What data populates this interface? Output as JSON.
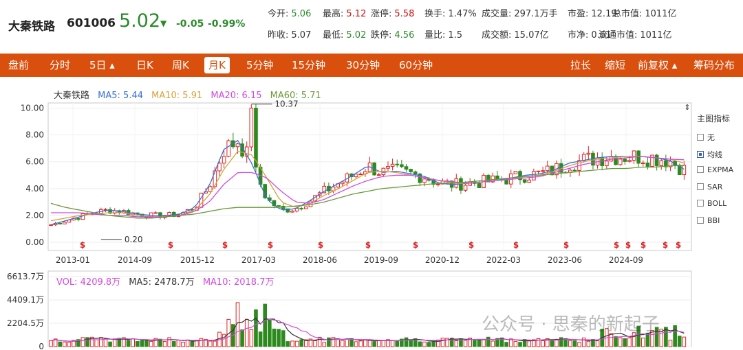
{
  "header": {
    "name": "大秦铁路",
    "code": "601006",
    "price": "5.02",
    "arrow": "▼",
    "change": "-0.05",
    "change_pct": "-0.99%",
    "quotes": [
      {
        "label": "今开:",
        "value": "5.06",
        "tone": "green"
      },
      {
        "label": "最高:",
        "value": "5.12",
        "tone": "red"
      },
      {
        "label": "涨停:",
        "value": "5.58",
        "tone": "red"
      },
      {
        "label": "换手:",
        "value": "1.47%",
        "tone": "dark"
      },
      {
        "label": "成交量:",
        "value": "297.1万手",
        "tone": "dark"
      },
      {
        "label": "市盈:",
        "value": "12.19",
        "tone": "dark"
      },
      {
        "label": "总市值:",
        "value": "1011亿",
        "tone": "dark"
      },
      {
        "label": "昨收:",
        "value": "5.07",
        "tone": "dark"
      },
      {
        "label": "最低:",
        "value": "5.02",
        "tone": "green"
      },
      {
        "label": "跌停:",
        "value": "4.56",
        "tone": "green"
      },
      {
        "label": "量比:",
        "value": "1.5",
        "tone": "dark"
      },
      {
        "label": "成交额:",
        "value": "15.07亿",
        "tone": "dark"
      },
      {
        "label": "市净:",
        "value": "0.61",
        "tone": "dark"
      },
      {
        "label": "流通市值:",
        "value": "1011亿",
        "tone": "dark"
      }
    ]
  },
  "toolbar": {
    "items": [
      "盘前",
      "分时",
      "5日 ▴",
      "日K",
      "周K",
      "月K",
      "5分钟",
      "15分钟",
      "30分钟",
      "60分钟",
      "拉长",
      "缩短",
      "前复权 ▴",
      "筹码分布"
    ],
    "active": "月K"
  },
  "ma_legend": {
    "name": "大秦铁路",
    "ma5": "MA5: 5.44",
    "ma10": "MA10: 5.91",
    "ma20": "MA20: 6.15",
    "ma60": "MA60: 5.71"
  },
  "colors": {
    "up": "#e02020",
    "down": "#2c8a1e",
    "ma5": "#3a6fd8",
    "ma10": "#d7a23a",
    "ma20": "#d04adf",
    "ma60": "#6a9a3a",
    "toolbar_bg": "#d94f0e"
  },
  "side_panel": {
    "title": "主图指标",
    "options": [
      {
        "label": "无",
        "checked": false
      },
      {
        "label": "均线",
        "checked": true
      },
      {
        "label": "EXPMA",
        "checked": false
      },
      {
        "label": "SAR",
        "checked": false
      },
      {
        "label": "BOLL",
        "checked": false
      },
      {
        "label": "BBI",
        "checked": false
      }
    ]
  },
  "price_axis": [
    "10.00",
    "8.00",
    "6.00",
    "4.00",
    "2.00",
    "0.00"
  ],
  "date_axis": [
    "2013-01",
    "2014-09",
    "2015-12",
    "2017-03",
    "2018-06",
    "2019-09",
    "2020-12",
    "2022-03",
    "2023-06",
    "2024-09"
  ],
  "annotations": {
    "high": "10.37",
    "low": "0.20"
  },
  "vol_legend": {
    "vol": "VOL: 4209.8万",
    "ma5": "MA5: 2478.7万",
    "ma10": "MA10: 2018.7万"
  },
  "vol_axis": [
    "6613.7万",
    "4409.1万",
    "2204.5万",
    "0"
  ],
  "watermark": "公众号 · 思秦的新起子",
  "chart_data": {
    "type": "candlestick",
    "price_axis_range": [
      0,
      11
    ],
    "volume_axis_range": [
      0,
      6613.7
    ],
    "volume_unit": "万",
    "series": [
      {
        "name": "MA5",
        "values": [
          1.3,
          1.6,
          1.9,
          2.2,
          2.4,
          2.3,
          2.1,
          2.0,
          2.0,
          2.1,
          2.6,
          4.2,
          6.9,
          7.6,
          5.8,
          3.2,
          2.4,
          2.5,
          3.1,
          3.8,
          4.4,
          5.0,
          5.7,
          5.2,
          5.3,
          5.1,
          4.9,
          4.4,
          4.3,
          4.4,
          4.5,
          4.6,
          4.8,
          5.0,
          5.1,
          5.4,
          5.9,
          6.1,
          6.3,
          6.4,
          6.4,
          6.4,
          6.3,
          6.1,
          5.44
        ]
      },
      {
        "name": "MA10",
        "values": [
          1.6,
          1.8,
          2.0,
          2.1,
          2.2,
          2.2,
          2.0,
          1.9,
          1.9,
          2.0,
          2.4,
          3.5,
          5.4,
          6.8,
          6.5,
          4.8,
          3.0,
          2.6,
          2.9,
          3.5,
          4.0,
          4.6,
          5.2,
          5.3,
          5.2,
          5.0,
          4.8,
          4.6,
          4.4,
          4.4,
          4.5,
          4.6,
          4.7,
          4.9,
          5.0,
          5.3,
          5.7,
          6.0,
          6.2,
          6.3,
          6.4,
          6.4,
          6.3,
          6.2,
          5.91
        ]
      },
      {
        "name": "MA20",
        "values": [
          2.2,
          2.2,
          2.2,
          2.1,
          2.0,
          2.0,
          1.9,
          1.9,
          1.9,
          2.0,
          2.3,
          3.0,
          4.3,
          5.2,
          5.2,
          4.8,
          3.8,
          3.0,
          2.9,
          3.2,
          3.7,
          4.2,
          4.6,
          4.9,
          5.0,
          5.0,
          4.8,
          4.6,
          4.5,
          4.4,
          4.5,
          4.6,
          4.7,
          4.8,
          4.9,
          5.2,
          5.5,
          5.8,
          6.0,
          6.2,
          6.3,
          6.4,
          6.3,
          6.2,
          6.15
        ]
      },
      {
        "name": "MA60",
        "values": [
          2.9,
          2.6,
          2.4,
          2.2,
          2.0,
          1.9,
          1.8,
          1.8,
          1.9,
          2.0,
          2.1,
          2.3,
          2.5,
          2.6,
          2.6,
          2.6,
          2.6,
          2.7,
          2.8,
          3.0,
          3.3,
          3.6,
          3.8,
          4.0,
          4.1,
          4.2,
          4.3,
          4.4,
          4.4,
          4.5,
          4.6,
          4.7,
          4.8,
          4.9,
          5.0,
          5.1,
          5.2,
          5.3,
          5.4,
          5.5,
          5.5,
          5.6,
          5.6,
          5.7,
          5.71
        ]
      }
    ],
    "key_points": {
      "all_time_high": 10.37,
      "all_time_low": 0.2
    }
  }
}
